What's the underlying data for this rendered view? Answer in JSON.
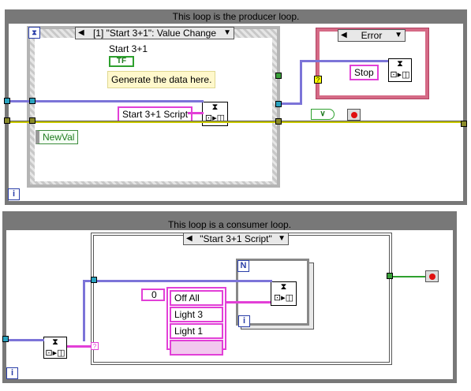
{
  "producer": {
    "title": "This loop is the producer loop.",
    "iteration_label": "i",
    "event_case_label": "[1] \"Start 3+1\": Value Change",
    "button_label": "Start 3+1",
    "bool_terminal": "TF",
    "comment": "Generate the data here.",
    "enqueue_message": "Start 3+1 Script",
    "control_label": "NewVal",
    "error_case": "Error",
    "stop_message": "Stop"
  },
  "consumer": {
    "title": "This loop is a consumer loop.",
    "iteration_label": "i",
    "case_label": "\"Start 3+1 Script\"",
    "index_value": "0",
    "array_items": [
      "Off All",
      "Light 3",
      "Light 1"
    ],
    "for_loop_count": "N",
    "for_loop_iter": "i"
  },
  "colors": {
    "loop_border": "#787878",
    "string_wire": "#e23fd7",
    "queue_wire": "#2aa3c0",
    "error_wire": "#c8c800",
    "stop_red": "#e01010"
  }
}
